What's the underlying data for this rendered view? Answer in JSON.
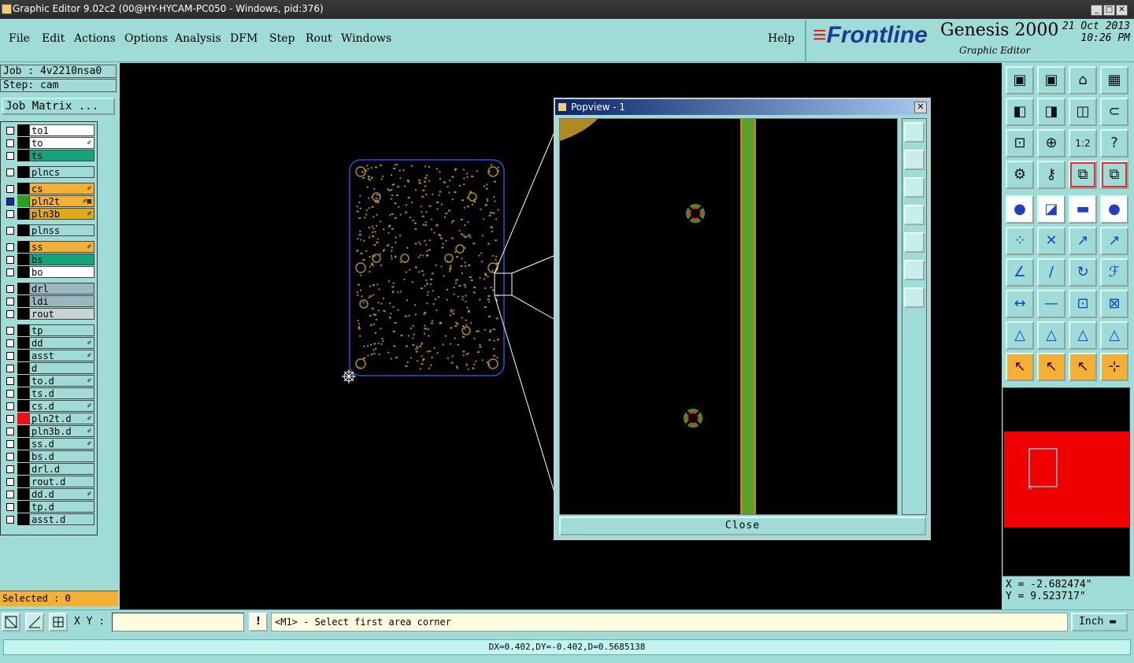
{
  "window": {
    "title": "Graphic Editor 9.02c2 (00@HY-HYCAM-PC050 - Windows, pid:376)",
    "controls": [
      "_",
      "□",
      "✕"
    ]
  },
  "menu": {
    "items": [
      "File",
      "Edit",
      "Actions",
      "Options",
      "Analysis",
      "DFM",
      "Step",
      "Rout",
      "Windows"
    ],
    "help": "Help"
  },
  "brand": {
    "logo": "Frontline",
    "product": "Genesis 2000",
    "subtitle": "Graphic Editor",
    "date": "21 Oct 2013",
    "time": "10:26 PM"
  },
  "left": {
    "job": "Job : 4v2210nsa0",
    "step": "Step: cam",
    "job_matrix": "Job Matrix ...",
    "selected": "Selected : 0",
    "layers": [
      {
        "name": "to1",
        "bg": "#ffffff",
        "color": "#000000",
        "edit": ""
      },
      {
        "name": "to",
        "bg": "#ffffff",
        "color": "#000000",
        "edit": "✐"
      },
      {
        "name": "ts",
        "bg": "#18a47a",
        "color": "#000000",
        "edit": ""
      },
      {
        "name": "plncs",
        "bg": "#9fdcd8",
        "color": "#000000",
        "edit": ""
      },
      {
        "name": "cs",
        "bg": "#f4b034",
        "color": "#000000",
        "edit": "✐"
      },
      {
        "name": "pln2t",
        "bg": "#f4b034",
        "color": "#2aa020",
        "edit": "✐▦"
      },
      {
        "name": "pln3b",
        "bg": "#e0a81c",
        "color": "#000000",
        "edit": "✐"
      },
      {
        "name": "plnss",
        "bg": "#9fdcd8",
        "color": "#000000",
        "edit": ""
      },
      {
        "name": "ss",
        "bg": "#f4b034",
        "color": "#000000",
        "edit": "✐"
      },
      {
        "name": "bs",
        "bg": "#18a47a",
        "color": "#000000",
        "edit": ""
      },
      {
        "name": "bo",
        "bg": "#ffffff",
        "color": "#000000",
        "edit": ""
      },
      {
        "name": "drl",
        "bg": "#9bb8c0",
        "color": "#000000",
        "edit": ""
      },
      {
        "name": "ldi",
        "bg": "#9bb8c0",
        "color": "#000000",
        "edit": ""
      },
      {
        "name": "rout",
        "bg": "#c8d4d4",
        "color": "#000000",
        "edit": ""
      },
      {
        "name": "tp",
        "bg": "#9fdcd8",
        "color": "#000000",
        "edit": ""
      },
      {
        "name": "dd",
        "bg": "#9fdcd8",
        "color": "#000000",
        "edit": "✐"
      },
      {
        "name": "asst",
        "bg": "#9fdcd8",
        "color": "#000000",
        "edit": "✐"
      },
      {
        "name": "d",
        "bg": "#9fdcd8",
        "color": "#000000",
        "edit": ""
      },
      {
        "name": "to.d",
        "bg": "#9fdcd8",
        "color": "#000000",
        "edit": "✐"
      },
      {
        "name": "ts.d",
        "bg": "#9fdcd8",
        "color": "#000000",
        "edit": ""
      },
      {
        "name": "cs.d",
        "bg": "#9fdcd8",
        "color": "#000000",
        "edit": "✐"
      },
      {
        "name": "pln2t.d",
        "bg": "#9fdcd8",
        "color": "#ee1111",
        "edit": "✐"
      },
      {
        "name": "pln3b.d",
        "bg": "#9fdcd8",
        "color": "#000000",
        "edit": "✐"
      },
      {
        "name": "ss.d",
        "bg": "#9fdcd8",
        "color": "#000000",
        "edit": "✐"
      },
      {
        "name": "bs.d",
        "bg": "#9fdcd8",
        "color": "#000000",
        "edit": ""
      },
      {
        "name": "drl.d",
        "bg": "#9fdcd8",
        "color": "#000000",
        "edit": ""
      },
      {
        "name": "rout.d",
        "bg": "#9fdcd8",
        "color": "#000000",
        "edit": ""
      },
      {
        "name": "dd.d",
        "bg": "#9fdcd8",
        "color": "#000000",
        "edit": "✐"
      },
      {
        "name": "tp.d",
        "bg": "#9fdcd8",
        "color": "#000000",
        "edit": ""
      },
      {
        "name": "asst.d",
        "bg": "#9fdcd8",
        "color": "#000000",
        "edit": ""
      }
    ]
  },
  "popview": {
    "title": "Popview - 1",
    "close_label": "Close"
  },
  "coords": {
    "x": "X = -2.682474\"",
    "y": "Y = 9.523717\""
  },
  "command": {
    "xy_label": "X Y :",
    "xy_value": "",
    "warn": "!",
    "prompt": "<M1> - Select first area corner",
    "units": "Inch"
  },
  "status": {
    "measure": "DX=0.402,DY=-0.402,D=0.5685138"
  },
  "colors": {
    "panel": "#9fdcd8",
    "layer_active": "#f4b034",
    "board_features": "#b08a20",
    "overview_red": "#f10000"
  }
}
